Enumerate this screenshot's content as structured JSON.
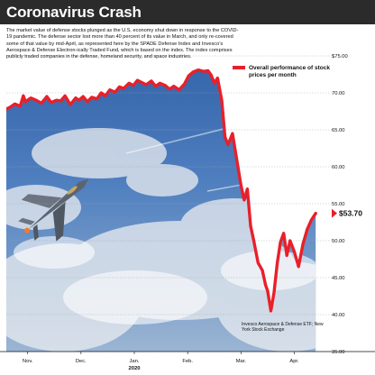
{
  "header": {
    "title": "Coronavirus Crash",
    "description": "The market value of defense stocks plunged as the U.S. economy shut down in response to the COVID-19 pandemic. The defense sector lost more than 40 percent of its value in March, and only re-covered some of that value by mid-April, as represented here by the SPADE Defense Index and Invesco’s Aerospace & Defense Electron-ically Traded Fund, which is based on the index. The index comprises publicly traded companies in the defense, homeland security, and space industries."
  },
  "source_note": "Invesco Aerospace & Defense ETF; New York Stock Exchange",
  "colors": {
    "series": "#e8202a",
    "sky_top": "#2f5fa6",
    "cloud": "#e6eaef",
    "frame": "#111111",
    "text": "#111111",
    "title": "#ffffff"
  },
  "icons": [
    "fighter-jet-icon"
  ],
  "chart_data": {
    "type": "line",
    "title": "Coronavirus Crash",
    "xlabel": "",
    "ylabel": "",
    "ylim": [
      35,
      75
    ],
    "y_ticks": [
      "$75.00",
      "70.00",
      "65.00",
      "60.00",
      "55.00",
      "50.00",
      "45.00",
      "40.00",
      "35.00"
    ],
    "y_tick_values": [
      75,
      70,
      65,
      60,
      55,
      50,
      45,
      40,
      35
    ],
    "x_ticks": [
      "Nov.",
      "Dec.",
      "Jan.",
      "Feb.",
      "Mar.",
      "Apr."
    ],
    "x_tick_positions": [
      0.4,
      1.4,
      2.4,
      3.4,
      4.4,
      5.4
    ],
    "x_year_label": "2020",
    "x_range": [
      0,
      6
    ],
    "grid": true,
    "legend_position": "top-right",
    "series": [
      {
        "name": "Overall performance of stock prices per month",
        "x": [
          0,
          0.08,
          0.16,
          0.26,
          0.32,
          0.36,
          0.46,
          0.56,
          0.66,
          0.76,
          0.84,
          0.94,
          1.02,
          1.1,
          1.2,
          1.3,
          1.36,
          1.44,
          1.52,
          1.6,
          1.7,
          1.78,
          1.86,
          1.94,
          2.04,
          2.12,
          2.2,
          2.3,
          2.38,
          2.46,
          2.54,
          2.62,
          2.72,
          2.8,
          2.88,
          2.98,
          3.06,
          3.14,
          3.24,
          3.34,
          3.42,
          3.5,
          3.6,
          3.7,
          3.78,
          3.84,
          3.9,
          3.96,
          4.04,
          4.1,
          4.16,
          4.24,
          4.32,
          4.4,
          4.46,
          4.52,
          4.58,
          4.64,
          4.72,
          4.8,
          4.86,
          4.9,
          4.96,
          5.02,
          5.08,
          5.14,
          5.2,
          5.26,
          5.32,
          5.4,
          5.48,
          5.56,
          5.64,
          5.72,
          5.8
        ],
        "values": [
          67.8,
          68.1,
          68.5,
          68.2,
          69.6,
          68.8,
          69.3,
          69.0,
          68.6,
          69.5,
          68.7,
          69.0,
          68.9,
          69.6,
          68.4,
          69.3,
          69.0,
          69.5,
          68.8,
          69.4,
          69.2,
          70.0,
          69.6,
          70.4,
          70.1,
          70.8,
          70.6,
          71.3,
          71.0,
          71.7,
          71.4,
          71.1,
          71.6,
          70.9,
          71.3,
          71.0,
          70.5,
          70.9,
          70.4,
          71.2,
          72.3,
          72.8,
          73.1,
          72.9,
          73.0,
          72.4,
          71.3,
          72.0,
          69.0,
          64.0,
          63.0,
          64.5,
          61.0,
          57.5,
          55.5,
          57.0,
          52.0,
          50.0,
          47.0,
          46.0,
          44.0,
          43.2,
          40.5,
          43.0,
          47.0,
          49.8,
          51.0,
          48.0,
          50.0,
          48.5,
          46.5,
          49.5,
          51.5,
          52.8,
          53.7
        ]
      }
    ],
    "annotations": [
      {
        "label": "$53.70",
        "x": 5.8,
        "y": 53.7
      }
    ]
  }
}
